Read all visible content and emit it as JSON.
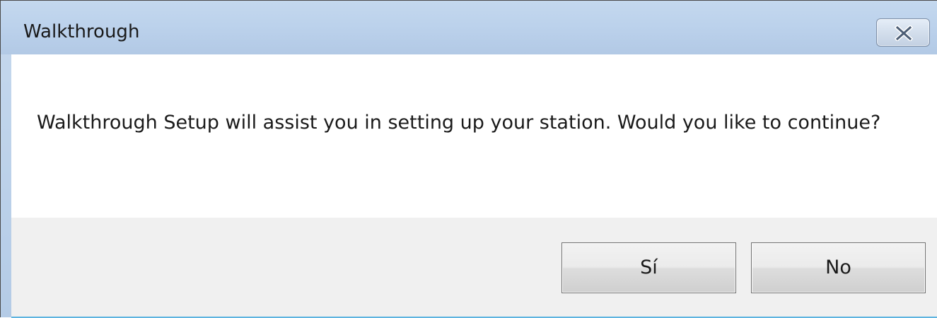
{
  "window": {
    "title": "Walkthrough",
    "close_icon": "close-x-icon"
  },
  "dialog": {
    "message": "Walkthrough Setup will assist you in setting up your station.  Would you like to continue?",
    "buttons": {
      "yes_label": "Sí",
      "no_label": "No"
    }
  },
  "colors": {
    "titlebar": "#bcd2ec",
    "button_area": "#f0f0f0",
    "accent_line": "#5fb4e0"
  }
}
